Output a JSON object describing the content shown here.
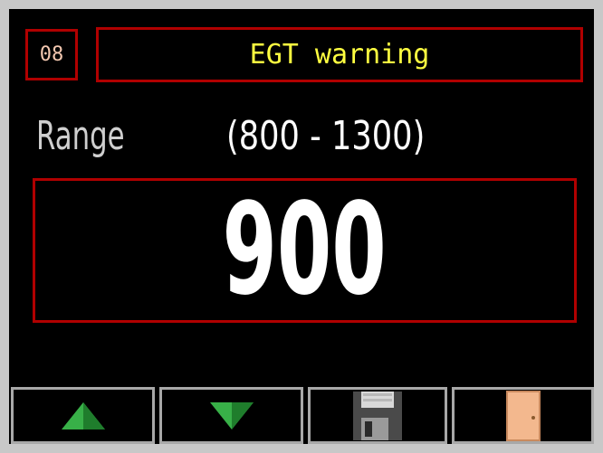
{
  "header": {
    "id": "08",
    "title": "EGT warning"
  },
  "range": {
    "label": "Range",
    "value": "(800 - 1300)"
  },
  "value": "900",
  "toolbar": {
    "buttons": [
      {
        "name": "up",
        "icon": "up-arrow-icon"
      },
      {
        "name": "down",
        "icon": "down-arrow-icon"
      },
      {
        "name": "save",
        "icon": "floppy-disk-icon"
      },
      {
        "name": "exit",
        "icon": "door-icon"
      }
    ]
  },
  "colors": {
    "border": "#b00000",
    "title": "#ffff40",
    "id_text": "#f4c8b0",
    "arrow": "#2e9e3e",
    "door": "#f3b88e"
  }
}
